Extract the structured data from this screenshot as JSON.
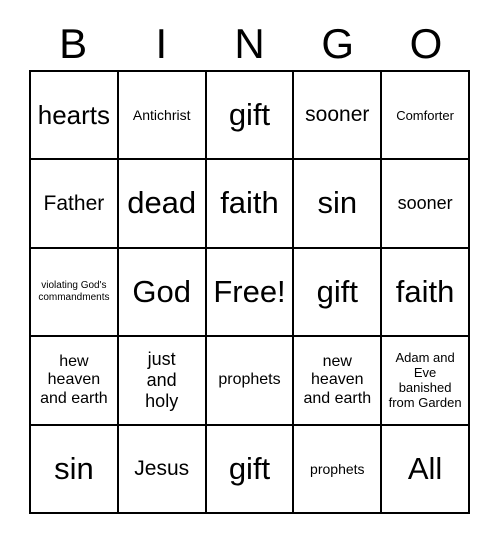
{
  "card": {
    "type": "bingo-card",
    "header_letters": [
      "B",
      "I",
      "N",
      "G",
      "O"
    ],
    "free_space": "Free!",
    "grid_size": "5x5",
    "border_color": "#000000",
    "background_color": "#ffffff",
    "text_color": "#000000"
  },
  "rows": [
    {
      "cells": [
        {
          "text": "hearts",
          "size": "xl"
        },
        {
          "text": "Antichrist",
          "size": "sm"
        },
        {
          "text": "gift",
          "size": "xxl"
        },
        {
          "text": "sooner",
          "size": "l"
        },
        {
          "text": "Comforter",
          "size": "s"
        }
      ]
    },
    {
      "cells": [
        {
          "text": "Father",
          "size": "l"
        },
        {
          "text": "dead",
          "size": "xxl"
        },
        {
          "text": "faith",
          "size": "xxl"
        },
        {
          "text": "sin",
          "size": "xxl"
        },
        {
          "text": "sooner",
          "size": "ml"
        }
      ]
    },
    {
      "cells": [
        {
          "text": "violating God's\ncommandments",
          "size": "xs"
        },
        {
          "text": "God",
          "size": "xxl"
        },
        {
          "text": "Free!",
          "size": "xxl"
        },
        {
          "text": "gift",
          "size": "xxl"
        },
        {
          "text": "faith",
          "size": "xxl"
        }
      ]
    },
    {
      "cells": [
        {
          "text": "hew\nheaven\nand earth",
          "size": "m"
        },
        {
          "text": "just\nand\nholy",
          "size": "ml"
        },
        {
          "text": "prophets",
          "size": "m"
        },
        {
          "text": "new\nheaven\nand earth",
          "size": "m"
        },
        {
          "text": "Adam and\nEve\nbanished\nfrom Garden",
          "size": "s"
        }
      ]
    },
    {
      "cells": [
        {
          "text": "sin",
          "size": "xxl"
        },
        {
          "text": "Jesus",
          "size": "l"
        },
        {
          "text": "gift",
          "size": "xxl"
        },
        {
          "text": "prophets",
          "size": "sm"
        },
        {
          "text": "All",
          "size": "xxl"
        }
      ]
    }
  ]
}
